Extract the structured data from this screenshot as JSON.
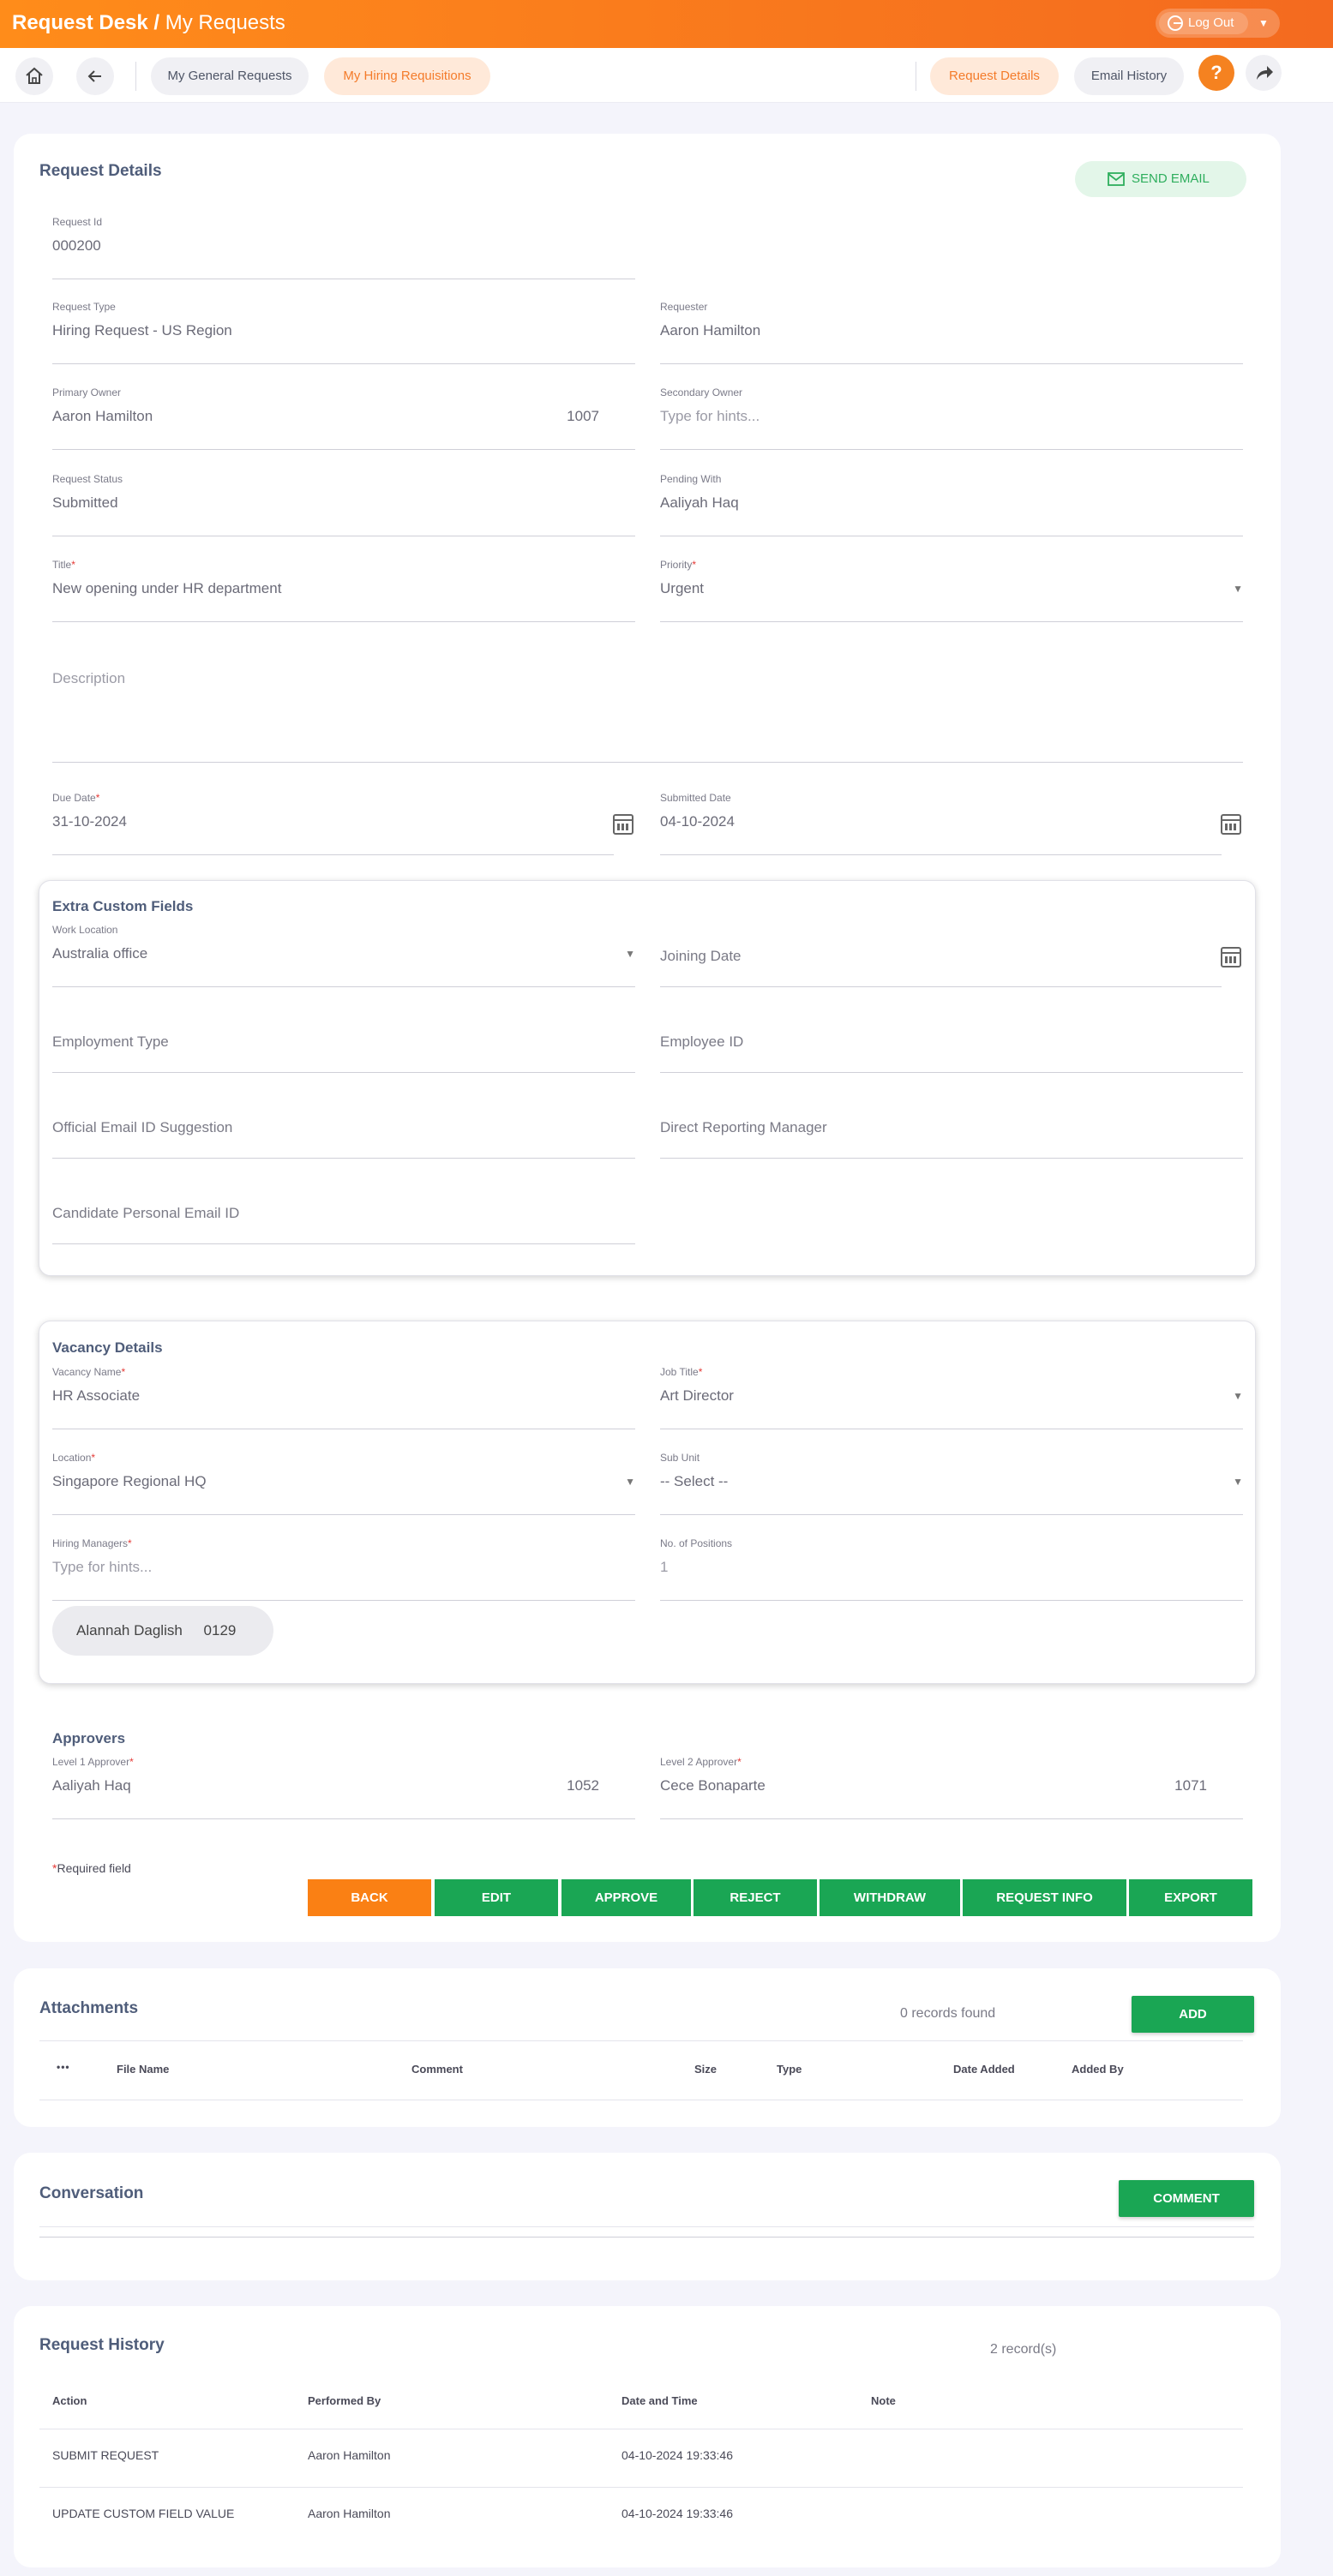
{
  "header": {
    "brand": "Request Desk /",
    "subtitle": "My Requests",
    "logout_label": "Log Out"
  },
  "nav": {
    "tabs": [
      "My General Requests",
      "My Hiring Requisitions"
    ],
    "right_tabs": [
      "Request Details",
      "Email History"
    ],
    "help": "?"
  },
  "request_details": {
    "title": "Request Details",
    "send_email": "SEND EMAIL",
    "fields": {
      "request_id": {
        "label": "Request Id",
        "value": "000200"
      },
      "request_type": {
        "label": "Request Type",
        "value": "Hiring Request - US Region"
      },
      "requester": {
        "label": "Requester",
        "value": "Aaron Hamilton"
      },
      "primary_owner": {
        "label": "Primary Owner",
        "value": "Aaron Hamilton",
        "badge": "1007"
      },
      "secondary_owner": {
        "label": "Secondary Owner",
        "placeholder": "Type for hints..."
      },
      "request_status": {
        "label": "Request Status",
        "value": "Submitted"
      },
      "pending_with": {
        "label": "Pending With",
        "value": "Aaliyah Haq"
      },
      "title": {
        "label": "Title",
        "value": "New opening under HR department"
      },
      "priority": {
        "label": "Priority",
        "value": "Urgent"
      },
      "description": {
        "label": "Description"
      },
      "due_date": {
        "label": "Due Date",
        "value": "31-10-2024"
      },
      "submitted_date": {
        "label": "Submitted Date",
        "value": "04-10-2024"
      }
    },
    "extra": {
      "title": "Extra Custom Fields",
      "work_location": {
        "label": "Work Location",
        "value": "Australia office"
      },
      "joining_date": "Joining Date",
      "employment_type": "Employment Type",
      "employee_id": "Employee ID",
      "official_email": "Official Email ID Suggestion",
      "direct_manager": "Direct Reporting Manager",
      "personal_email": "Candidate Personal Email ID"
    },
    "vacancy": {
      "title": "Vacancy Details",
      "vacancy_name": {
        "label": "Vacancy Name",
        "value": "HR Associate"
      },
      "job_title": {
        "label": "Job Title",
        "value": "Art Director"
      },
      "location": {
        "label": "Location",
        "value": "Singapore Regional HQ"
      },
      "sub_unit": {
        "label": "Sub Unit",
        "value": "-- Select --"
      },
      "hiring_managers": {
        "label": "Hiring Managers",
        "placeholder": "Type for hints..."
      },
      "positions": {
        "label": "No. of Positions",
        "value": "1"
      },
      "chip": {
        "name": "Alannah Daglish",
        "id": "0129"
      }
    },
    "approvers": {
      "title": "Approvers",
      "level1": {
        "label": "Level 1 Approver",
        "value": "Aaliyah Haq",
        "badge": "1052"
      },
      "level2": {
        "label": "Level 2 Approver",
        "value": "Cece Bonaparte",
        "badge": "1071"
      }
    },
    "required_note": "Required field",
    "required_star": "*",
    "buttons": [
      "BACK",
      "EDIT",
      "APPROVE",
      "REJECT",
      "WITHDRAW",
      "REQUEST INFO",
      "EXPORT"
    ]
  },
  "attachments": {
    "title": "Attachments",
    "count": "0 records found",
    "add": "ADD",
    "menu": "•••",
    "columns": [
      "File Name",
      "Comment",
      "Size",
      "Type",
      "Date Added",
      "Added By"
    ]
  },
  "conversation": {
    "title": "Conversation",
    "comment": "COMMENT"
  },
  "history": {
    "title": "Request History",
    "count": "2 record(s)",
    "columns": [
      "Action",
      "Performed By",
      "Date and Time",
      "Note"
    ],
    "rows": [
      {
        "action": "SUBMIT REQUEST",
        "by": "Aaron Hamilton",
        "time": "04-10-2024 19:33:46"
      },
      {
        "action": "UPDATE CUSTOM FIELD VALUE",
        "by": "Aaron Hamilton",
        "time": "04-10-2024 19:33:46"
      }
    ]
  }
}
